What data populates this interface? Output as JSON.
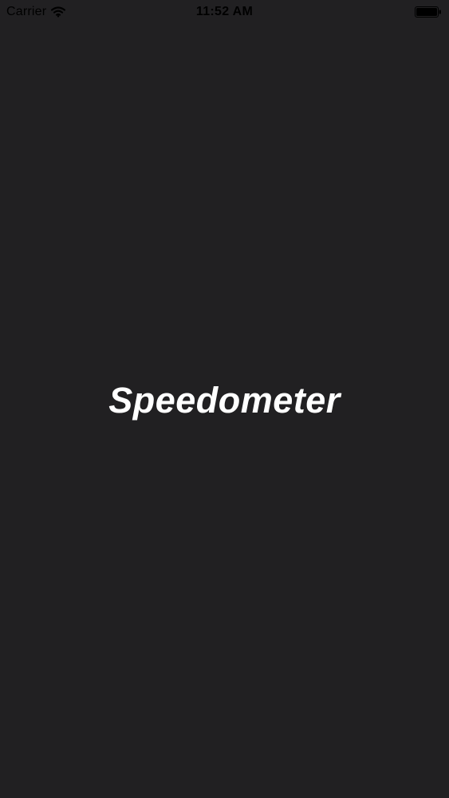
{
  "status_bar": {
    "carrier": "Carrier",
    "time": "11:52 AM",
    "icons": {
      "wifi": "wifi-icon",
      "battery": "battery-icon"
    }
  },
  "splash": {
    "title": "Speedometer"
  },
  "colors": {
    "background": "#212022",
    "title_text": "#ffffff",
    "status_text": "#000000"
  }
}
